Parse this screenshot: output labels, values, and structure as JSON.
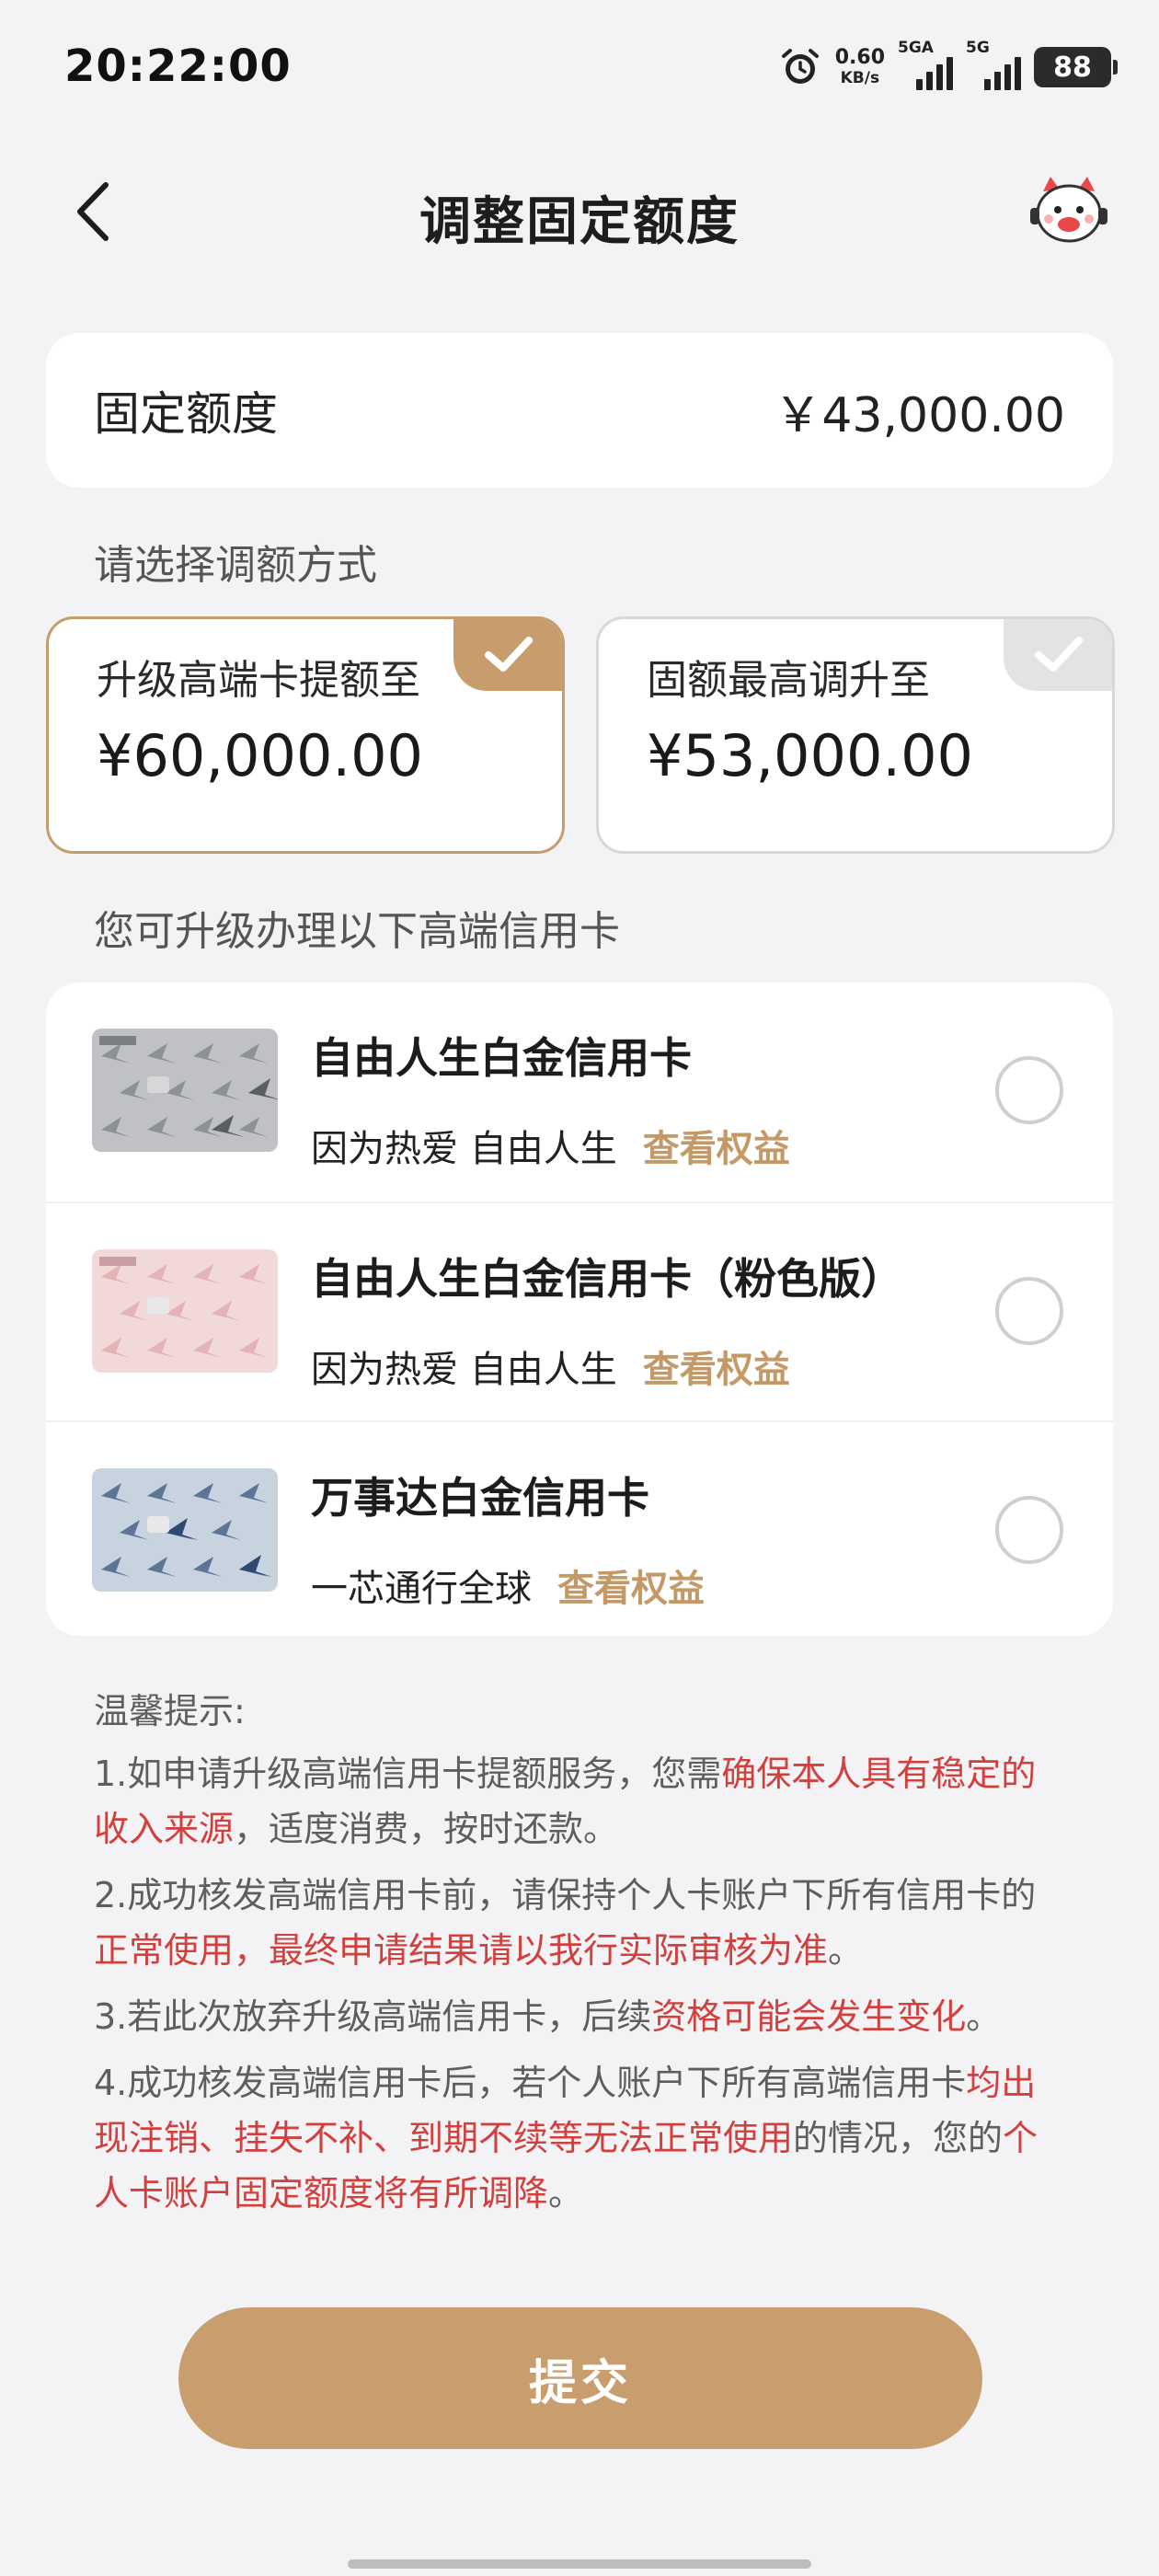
{
  "status_bar": {
    "time": "20:22:00",
    "net_speed_value": "0.60",
    "net_speed_unit": "KB/s",
    "signal1_label": "5GA",
    "signal2_label": "5G",
    "battery": "88",
    "icons": [
      "alarm-icon",
      "signal-icon",
      "battery-icon"
    ]
  },
  "nav": {
    "title": "调整固定额度",
    "back_icon": "chevron-left-icon",
    "assistant_icon": "assistant-mascot-icon"
  },
  "quota": {
    "label": "固定额度",
    "value": "￥43,000.00"
  },
  "method_section_label": "请选择调额方式",
  "options": [
    {
      "label": "升级高端卡提额至",
      "amount": "¥60,000.00",
      "selected": true
    },
    {
      "label": "固额最高调升至",
      "amount": "¥53,000.00",
      "selected": false
    }
  ],
  "upgrade_section_label": "您可升级办理以下高端信用卡",
  "cards": [
    {
      "name": "自由人生白金信用卡",
      "slogan": "因为热爱 自由人生",
      "link": "查看权益",
      "selected": false
    },
    {
      "name": "自由人生白金信用卡（粉色版）",
      "slogan": "因为热爱 自由人生",
      "link": "查看权益",
      "selected": false
    },
    {
      "name": "万事达白金信用卡",
      "slogan": "一芯通行全球",
      "link": "查看权益",
      "selected": false
    }
  ],
  "tips": {
    "title": "温馨提示:",
    "items": [
      {
        "a": "1.如申请升级高端信用卡提额服务，您需",
        "b": "确保本人具有稳定的收入来源",
        "c": "，适度消费，按时还款。"
      },
      {
        "a": "2.成功核发高端信用卡前，请保持个人卡账户下所有信用卡的",
        "b": "正常使用，最终申请结果请以我行实际审核为准",
        "c": "。"
      },
      {
        "a": "3.若此次放弃升级高端信用卡，后续",
        "b": "资格可能会发生变化",
        "c": "。"
      },
      {
        "a": "4.成功核发高端信用卡后，若个人账户下所有高端信用卡",
        "b": "均出现注销、挂失不补、到期不续等无法正常使用",
        "c": "的情况，您的",
        "d": "个人卡账户固定额度将有所调降",
        "e": "。"
      }
    ]
  },
  "submit_label": "提交",
  "colors": {
    "accent": "#c89e6f",
    "warning_text": "#d2403e",
    "background": "#f3f3f5"
  }
}
